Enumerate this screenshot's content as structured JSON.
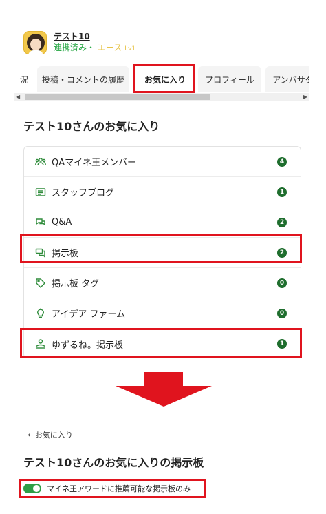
{
  "profile": {
    "name": "テスト10",
    "status": "連携済み",
    "separator": "・",
    "rank": "エース",
    "level": "Lv1"
  },
  "tabs": [
    {
      "label": "況"
    },
    {
      "label": "投稿・コメントの履歴"
    },
    {
      "label": "お気に入り",
      "active": true
    },
    {
      "label": "プロフィール"
    },
    {
      "label": "アンバサダ"
    }
  ],
  "favorites": {
    "title": "テスト10さんのお気に入り",
    "items": [
      {
        "label": "QAマイネ王メンバー",
        "count": "4",
        "icon": "members-icon"
      },
      {
        "label": "スタッフブログ",
        "count": "1",
        "icon": "blog-icon"
      },
      {
        "label": "Q&A",
        "count": "2",
        "icon": "qa-icon"
      },
      {
        "label": "掲示板",
        "count": "2",
        "icon": "board-icon"
      },
      {
        "label": "掲示板 タグ",
        "count": "0",
        "icon": "tag-icon"
      },
      {
        "label": "アイデア ファーム",
        "count": "0",
        "icon": "idea-icon"
      },
      {
        "label": "ゆずるね。掲示板",
        "count": "1",
        "icon": "yuzurune-icon"
      }
    ]
  },
  "board_page": {
    "back_label": "お気に入り",
    "title": "テスト10さんのお気に入りの掲示板",
    "toggle_label": "マイネ王アワードに推薦可能な掲示板のみ",
    "toggle_on": true
  },
  "colors": {
    "accent_green": "#2e8b3a",
    "badge_green": "#1f6e2e",
    "highlight_red": "#e0141e",
    "rank_yellow": "#e7c44b"
  }
}
